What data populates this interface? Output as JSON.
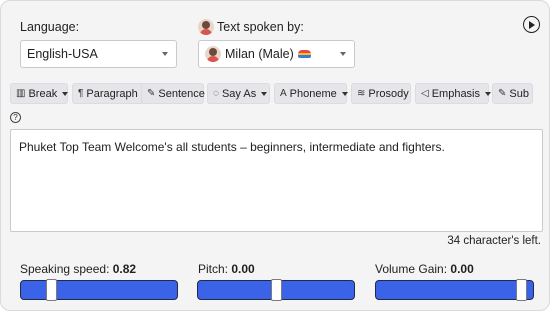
{
  "language": {
    "label": "Language:",
    "selected": "English-USA"
  },
  "voice": {
    "label": "Text spoken by:",
    "selected": "Milan (Male)"
  },
  "toolbar": {
    "items": [
      {
        "label": "Break",
        "icon": "break-icon",
        "dropdown": true
      },
      {
        "label": "Paragraph",
        "icon": "paragraph-icon",
        "dropdown": false
      },
      {
        "label": "Sentence",
        "icon": "pencil-icon",
        "dropdown": false
      },
      {
        "label": "Say As",
        "icon": "speech-bubble-icon",
        "dropdown": true
      },
      {
        "label": "Phoneme",
        "icon": "phoneme-icon",
        "dropdown": true
      },
      {
        "label": "Prosody",
        "icon": "waveform-icon",
        "dropdown": false
      },
      {
        "label": "Emphasis",
        "icon": "speaker-icon",
        "dropdown": true
      },
      {
        "label": "Sub",
        "icon": "edit-icon",
        "dropdown": false
      }
    ]
  },
  "editor": {
    "text": "Phuket Top Team Welcome's all students – beginners, intermediate and fighters."
  },
  "char_counter": "34 character's left.",
  "sliders": {
    "speed": {
      "label": "Speaking speed:",
      "value": "0.82",
      "fraction": 0.17
    },
    "pitch": {
      "label": "Pitch:",
      "value": "0.00",
      "fraction": 0.5
    },
    "volume": {
      "label": "Volume Gain:",
      "value": "0.00",
      "fraction": 0.96
    }
  },
  "colors": {
    "slider_fill": "#3b63e8",
    "panel_bg": "#f4f4f5"
  }
}
